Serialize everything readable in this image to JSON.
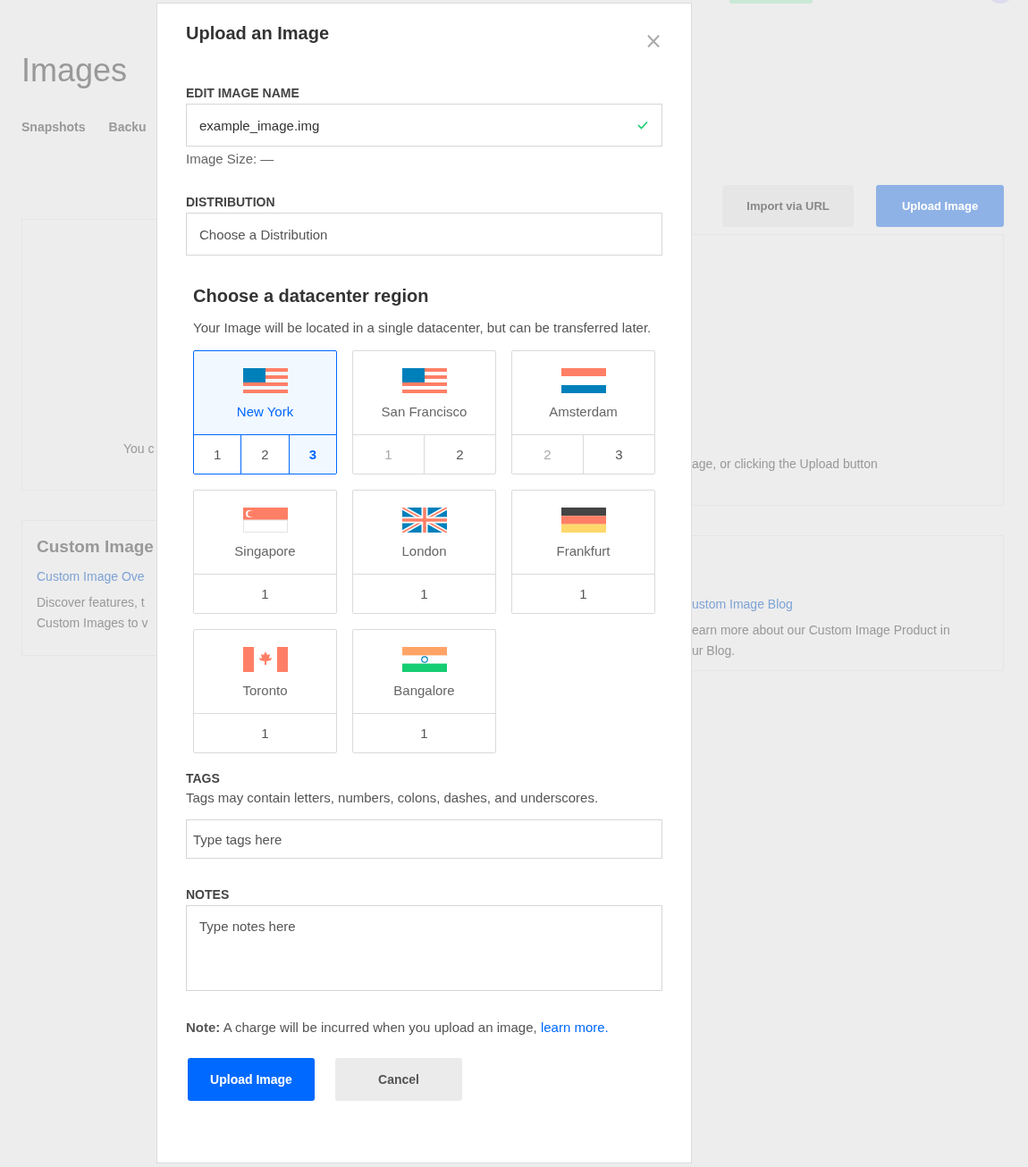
{
  "background": {
    "page_title": "Images",
    "tabs": [
      {
        "label": "Snapshots"
      },
      {
        "label": "Backu"
      }
    ],
    "buttons": [
      "Import via URL",
      "Upload Image"
    ],
    "empty_text_left": "You c",
    "empty_text_right": "age, or clicking the Upload button",
    "card_title": "Custom Image",
    "card_link_left": "Custom Image Ove",
    "card_lines_left": [
      "Discover features, t",
      "Custom Images to v"
    ],
    "card_link_right": "ustom Image Blog",
    "card_lines_right": [
      "earn more about our Custom Image Product in",
      "ur Blog."
    ]
  },
  "modal": {
    "title": "Upload an Image",
    "close": "×",
    "name_label": "EDIT IMAGE NAME",
    "name_value": "example_image.img",
    "name_valid": true,
    "image_size": "Image Size: —",
    "distribution_label": "DISTRIBUTION",
    "distribution_placeholder": "Choose a Distribution",
    "region_title": "Choose a datacenter region",
    "region_desc": "Your Image will be located in a single datacenter, but can be transferred later.",
    "regions": [
      {
        "name": "New York",
        "kind": "us",
        "selected": true,
        "options": [
          {
            "label": "1",
            "selected": false,
            "disabled": false
          },
          {
            "label": "2",
            "selected": false,
            "disabled": false
          },
          {
            "label": "3",
            "selected": true,
            "disabled": false
          }
        ]
      },
      {
        "name": "San Francisco",
        "kind": "us",
        "selected": false,
        "options": [
          {
            "label": "1",
            "selected": false,
            "disabled": true
          },
          {
            "label": "2",
            "selected": false,
            "disabled": false
          }
        ]
      },
      {
        "name": "Amsterdam",
        "kind": "nl",
        "selected": false,
        "options": [
          {
            "label": "2",
            "selected": false,
            "disabled": true
          },
          {
            "label": "3",
            "selected": false,
            "disabled": false
          }
        ]
      },
      {
        "name": "Singapore",
        "kind": "sg",
        "selected": false,
        "options": [
          {
            "label": "1",
            "selected": false,
            "disabled": false
          }
        ]
      },
      {
        "name": "London",
        "kind": "uk",
        "selected": false,
        "options": [
          {
            "label": "1",
            "selected": false,
            "disabled": false
          }
        ]
      },
      {
        "name": "Frankfurt",
        "kind": "de",
        "selected": false,
        "options": [
          {
            "label": "1",
            "selected": false,
            "disabled": false
          }
        ]
      },
      {
        "name": "Toronto",
        "kind": "ca",
        "selected": false,
        "options": [
          {
            "label": "1",
            "selected": false,
            "disabled": false
          }
        ]
      },
      {
        "name": "Bangalore",
        "kind": "in",
        "selected": false,
        "options": [
          {
            "label": "1",
            "selected": false,
            "disabled": false
          }
        ]
      }
    ],
    "tags_label": "TAGS",
    "tags_desc": "Tags may contain letters, numbers, colons, dashes, and underscores.",
    "tags_placeholder": "Type tags here",
    "notes_label": "NOTES",
    "notes_placeholder": "Type notes here",
    "note_text": "**Note:** A charge will be incurred when you upload an image, ",
    "note_link": "learn more.",
    "submit": "Upload Image",
    "cancel": "Cancel"
  }
}
